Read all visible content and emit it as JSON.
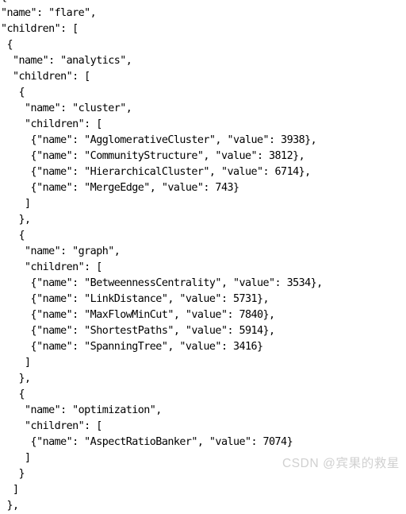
{
  "document": {
    "type": "json-code-listing",
    "language": "json",
    "background_color": "#ffffff",
    "text_color": "#000000",
    "lines": [
      "{",
      "\"name\": \"flare\",",
      "\"children\": [",
      " {",
      "  \"name\": \"analytics\",",
      "  \"children\": [",
      "   {",
      "    \"name\": \"cluster\",",
      "    \"children\": [",
      "     {\"name\": \"AgglomerativeCluster\", \"value\": 3938},",
      "     {\"name\": \"CommunityStructure\", \"value\": 3812},",
      "     {\"name\": \"HierarchicalCluster\", \"value\": 6714},",
      "     {\"name\": \"MergeEdge\", \"value\": 743}",
      "    ]",
      "   },",
      "   {",
      "    \"name\": \"graph\",",
      "    \"children\": [",
      "     {\"name\": \"BetweennessCentrality\", \"value\": 3534},",
      "     {\"name\": \"LinkDistance\", \"value\": 5731},",
      "     {\"name\": \"MaxFlowMinCut\", \"value\": 7840},",
      "     {\"name\": \"ShortestPaths\", \"value\": 5914},",
      "     {\"name\": \"SpanningTree\", \"value\": 3416}",
      "    ]",
      "   },",
      "   {",
      "    \"name\": \"optimization\",",
      "    \"children\": [",
      "     {\"name\": \"AspectRatioBanker\", \"value\": 7074}",
      "    ]",
      "   }",
      "  ]",
      " },"
    ]
  },
  "watermark": {
    "text": "CSDN @宾果的救星",
    "color": "#d0d0d0"
  }
}
